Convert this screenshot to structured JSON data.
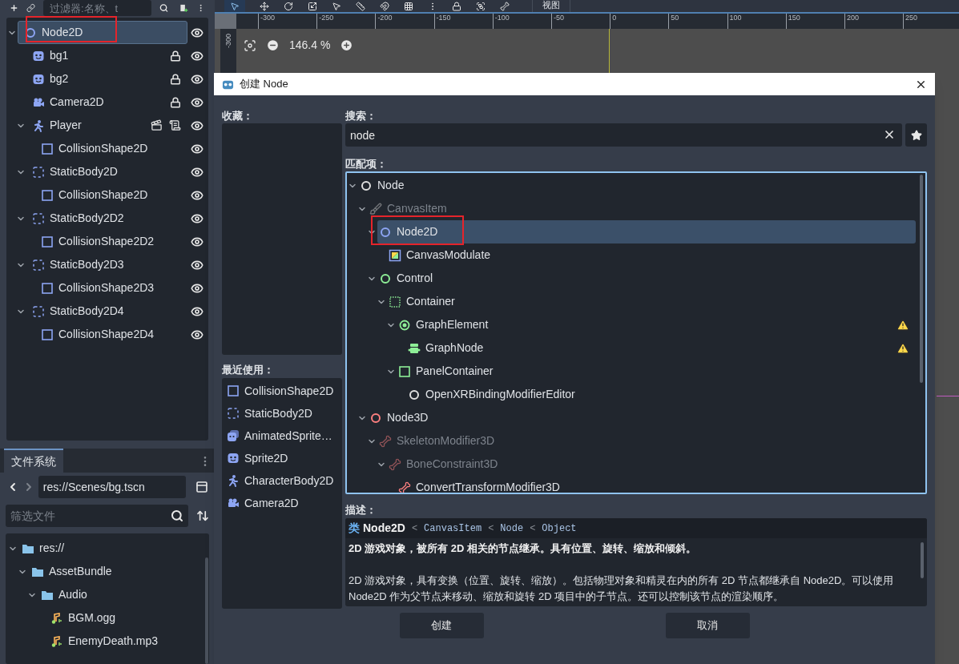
{
  "scene_dock": {
    "filter_placeholder": "过滤器:名称、t",
    "items": [
      {
        "name": "Node2D",
        "kind": "node2d",
        "selected": true,
        "highlighted": true,
        "expanded": true,
        "locked": false,
        "scene": false,
        "script": false,
        "visible": true,
        "children": [
          {
            "name": "bg1",
            "kind": "sprite",
            "selected": false,
            "highlighted": false,
            "locked": true,
            "scene": false,
            "script": false,
            "visible": true
          },
          {
            "name": "bg2",
            "kind": "sprite",
            "selected": false,
            "highlighted": false,
            "locked": true,
            "scene": false,
            "script": false,
            "visible": true
          },
          {
            "name": "Camera2D",
            "kind": "camera",
            "selected": false,
            "highlighted": false,
            "locked": true,
            "scene": false,
            "script": false,
            "visible": true
          },
          {
            "name": "Player",
            "kind": "character",
            "selected": false,
            "highlighted": false,
            "expanded": true,
            "locked": false,
            "scene": true,
            "script": true,
            "visible": true,
            "children": [
              {
                "name": "CollisionShape2D",
                "kind": "collision",
                "selected": false,
                "highlighted": false,
                "locked": false,
                "scene": false,
                "script": false,
                "visible": true
              }
            ]
          },
          {
            "name": "StaticBody2D",
            "kind": "static-body",
            "selected": false,
            "highlighted": false,
            "expanded": true,
            "locked": false,
            "scene": false,
            "script": false,
            "visible": true,
            "children": [
              {
                "name": "CollisionShape2D",
                "kind": "collision",
                "selected": false,
                "highlighted": false,
                "locked": false,
                "scene": false,
                "script": false,
                "visible": true
              }
            ]
          },
          {
            "name": "StaticBody2D2",
            "kind": "static-body",
            "selected": false,
            "highlighted": false,
            "expanded": true,
            "locked": false,
            "scene": false,
            "script": false,
            "visible": true,
            "children": [
              {
                "name": "CollisionShape2D2",
                "kind": "collision",
                "selected": false,
                "highlighted": false,
                "locked": false,
                "scene": false,
                "script": false,
                "visible": true
              }
            ]
          },
          {
            "name": "StaticBody2D3",
            "kind": "static-body",
            "selected": false,
            "highlighted": false,
            "expanded": true,
            "locked": false,
            "scene": false,
            "script": false,
            "visible": true,
            "children": [
              {
                "name": "CollisionShape2D3",
                "kind": "collision",
                "selected": false,
                "highlighted": false,
                "locked": false,
                "scene": false,
                "script": false,
                "visible": true
              }
            ]
          },
          {
            "name": "StaticBody2D4",
            "kind": "static-body",
            "selected": false,
            "highlighted": false,
            "expanded": true,
            "locked": false,
            "scene": false,
            "script": false,
            "visible": true,
            "children": [
              {
                "name": "CollisionShape2D4",
                "kind": "collision",
                "selected": false,
                "highlighted": false,
                "locked": false,
                "scene": false,
                "script": false,
                "visible": true
              }
            ]
          }
        ]
      }
    ]
  },
  "filesystem": {
    "tab": "文件系统",
    "path": "res://Scenes/bg.tscn",
    "filter_placeholder": "筛选文件",
    "items": [
      {
        "name": "res://",
        "kind": "folder",
        "selected": false,
        "expanded": true,
        "children": [
          {
            "name": "AssetBundle",
            "kind": "folder",
            "selected": false,
            "expanded": true,
            "children": [
              {
                "name": "Audio",
                "kind": "folder",
                "selected": false,
                "expanded": true,
                "children": [
                  {
                    "name": "BGM.ogg",
                    "kind": "audio",
                    "selected": false
                  },
                  {
                    "name": "EnemyDeath.mp3",
                    "kind": "audio",
                    "selected": false
                  }
                ]
              }
            ]
          }
        ]
      }
    ]
  },
  "editor": {
    "view_menu": "视图",
    "vertical_ruler_label": "-300",
    "ruler_labels": [
      "-300",
      "-250",
      "-200",
      "-150",
      "-100",
      "-50",
      "0",
      "50",
      "100",
      "150",
      "200",
      "250"
    ],
    "zoom": "146.4 %"
  },
  "dialog": {
    "title": "创建 Node",
    "favorites_label": "收藏：",
    "recent_label": "最近使用：",
    "recent": [
      {
        "name": "CollisionShape2D",
        "kind": "collision",
        "selected": false
      },
      {
        "name": "StaticBody2D",
        "kind": "static-body",
        "selected": false
      },
      {
        "name": "AnimatedSprite…",
        "kind": "animated-sprite",
        "selected": false
      },
      {
        "name": "Sprite2D",
        "kind": "sprite",
        "selected": false
      },
      {
        "name": "CharacterBody2D",
        "kind": "character",
        "selected": false
      },
      {
        "name": "Camera2D",
        "kind": "camera",
        "selected": false
      }
    ],
    "search_label": "搜索：",
    "search_value": "node",
    "matches_label": "匹配项：",
    "matches": [
      {
        "name": "Node",
        "kind": "node",
        "selected": false,
        "highlighted": false,
        "disabled": false,
        "warning": false,
        "expanded": true,
        "children": [
          {
            "name": "CanvasItem",
            "kind": "brush",
            "selected": false,
            "highlighted": false,
            "disabled": true,
            "warning": false,
            "expanded": true,
            "children": [
              {
                "name": "Node2D",
                "kind": "node2d",
                "selected": true,
                "highlighted": true,
                "disabled": false,
                "warning": false,
                "expanded": true,
                "children": [
                  {
                    "name": "CanvasModulate",
                    "kind": "modulate",
                    "selected": false,
                    "highlighted": false,
                    "disabled": false,
                    "warning": false
                  }
                ]
              },
              {
                "name": "Control",
                "kind": "control",
                "selected": false,
                "highlighted": false,
                "disabled": false,
                "warning": false,
                "expanded": true,
                "children": [
                  {
                    "name": "Container",
                    "kind": "container",
                    "selected": false,
                    "highlighted": false,
                    "disabled": false,
                    "warning": false,
                    "expanded": true,
                    "children": [
                      {
                        "name": "GraphElement",
                        "kind": "graph-element",
                        "selected": false,
                        "highlighted": false,
                        "disabled": false,
                        "warning": true,
                        "expanded": true,
                        "children": [
                          {
                            "name": "GraphNode",
                            "kind": "graph-node",
                            "selected": false,
                            "highlighted": false,
                            "disabled": false,
                            "warning": true
                          }
                        ]
                      },
                      {
                        "name": "PanelContainer",
                        "kind": "panel",
                        "selected": false,
                        "highlighted": false,
                        "disabled": false,
                        "warning": false,
                        "expanded": true,
                        "children": [
                          {
                            "name": "OpenXRBindingModifierEditor",
                            "kind": "node",
                            "selected": false,
                            "highlighted": false,
                            "disabled": false,
                            "warning": false
                          }
                        ]
                      }
                    ]
                  }
                ]
              }
            ]
          },
          {
            "name": "Node3D",
            "kind": "node3d",
            "selected": false,
            "highlighted": false,
            "disabled": false,
            "warning": false,
            "expanded": true,
            "children": [
              {
                "name": "SkeletonModifier3D",
                "kind": "skeleton",
                "selected": false,
                "highlighted": false,
                "disabled": true,
                "warning": false,
                "expanded": true,
                "children": [
                  {
                    "name": "BoneConstraint3D",
                    "kind": "bone",
                    "selected": false,
                    "highlighted": false,
                    "disabled": true,
                    "warning": false,
                    "expanded": true,
                    "children": [
                      {
                        "name": "ConvertTransformModifier3D",
                        "kind": "bone",
                        "selected": false,
                        "highlighted": false,
                        "disabled": false,
                        "warning": false
                      }
                    ]
                  }
                ]
              }
            ]
          }
        ]
      }
    ],
    "description_label": "描述：",
    "class_keyword": "类",
    "class_name": "Node2D",
    "inheritance_separator": "<",
    "inheritance": [
      "CanvasItem",
      "Node",
      "Object"
    ],
    "summary": "2D 游戏对象，被所有 2D 相关的节点继承。具有位置、旋转、缩放和倾斜。",
    "body": "2D 游戏对象，具有变换（位置、旋转、缩放）。包括物理对象和精灵在内的所有 2D 节点都继承自 Node2D。可以使用 Node2D 作为父节点来移动、缩放和旋转 2D 项目中的子节点。还可以控制该节点的渲染顺序。",
    "buttons": [
      {
        "label": "创建"
      },
      {
        "label": "取消"
      }
    ]
  }
}
